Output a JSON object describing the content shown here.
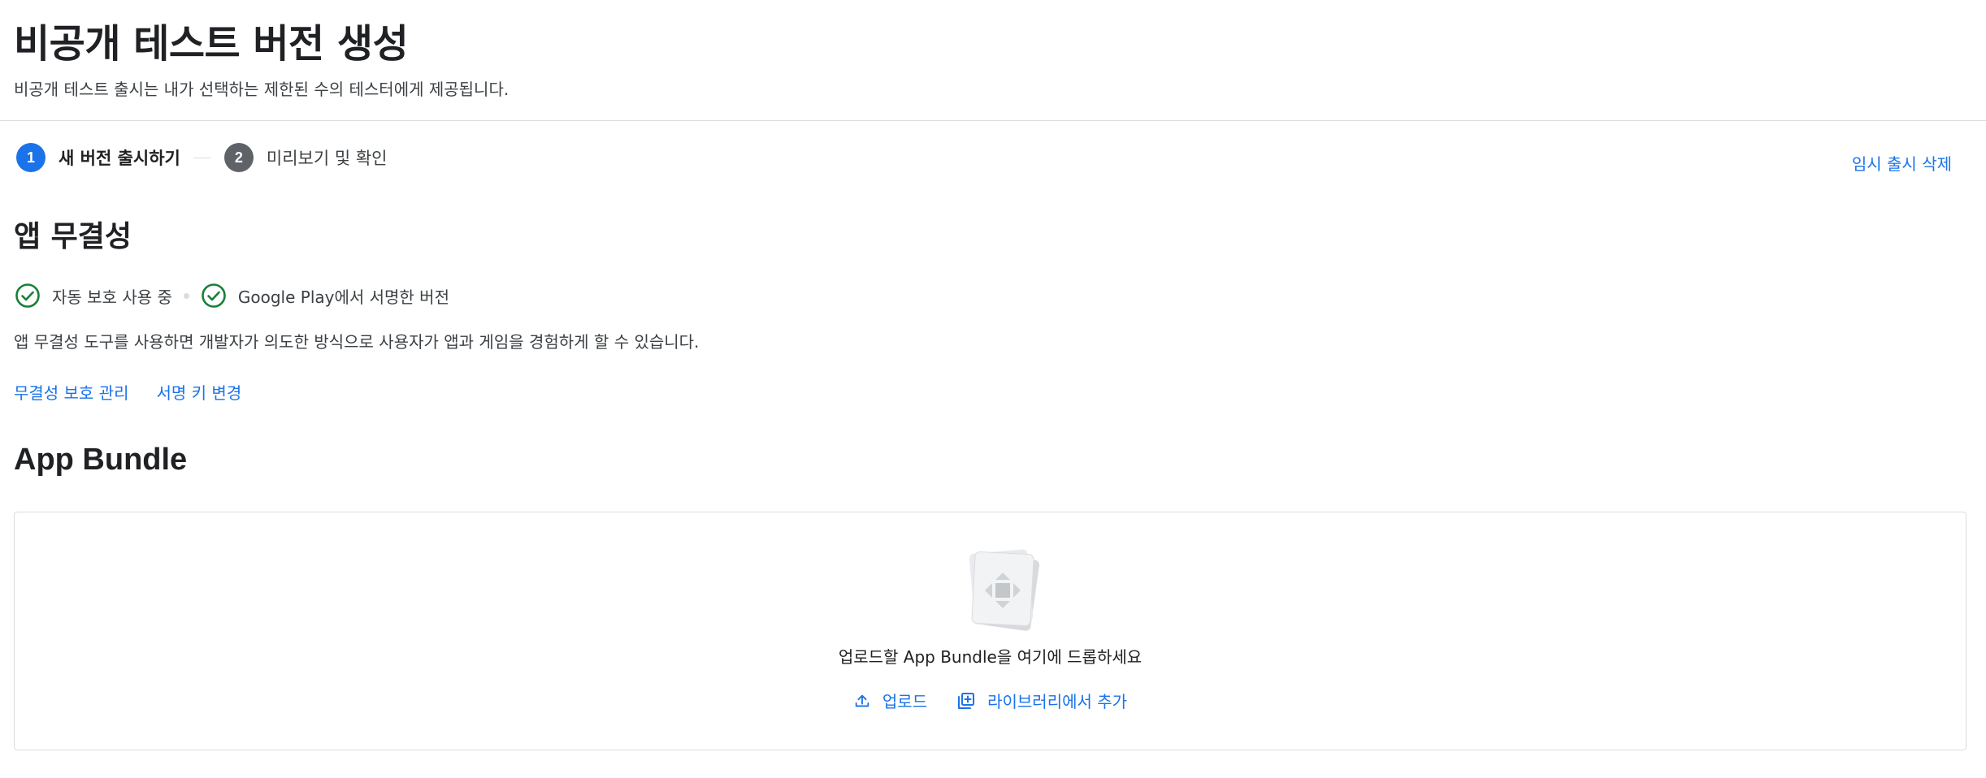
{
  "header": {
    "title": "비공개 테스트 버전 생성",
    "subtitle": "비공개 테스트 출시는 내가 선택하는 제한된 수의 테스터에게 제공됩니다."
  },
  "stepper": {
    "steps": [
      {
        "number": "1",
        "label": "새 버전 출시하기",
        "active": true
      },
      {
        "number": "2",
        "label": "미리보기 및 확인",
        "active": false
      }
    ]
  },
  "actions": {
    "discard_label": "임시 출시 삭제"
  },
  "integrity": {
    "title": "앱 무결성",
    "statuses": [
      {
        "label": "자동 보호 사용 중",
        "icon": "check-circle-icon"
      },
      {
        "label": "Google Play에서 서명한 버전",
        "icon": "check-circle-icon"
      }
    ],
    "description": "앱 무결성 도구를 사용하면 개발자가 의도한 방식으로 사용자가 앱과 게임을 경험하게 할 수 있습니다.",
    "links": {
      "manage_protection": "무결성 보호 관리",
      "change_signing_key": "서명 키 변경"
    }
  },
  "bundle": {
    "title": "App Bundle",
    "drop_text": "업로드할 App Bundle을 여기에 드롭하세요",
    "upload_label": "업로드",
    "add_from_library_label": "라이브러리에서 추가"
  },
  "colors": {
    "accent": "#1a73e8",
    "success": "#188038",
    "step_inactive": "#5f6368",
    "border": "#dadce0"
  }
}
